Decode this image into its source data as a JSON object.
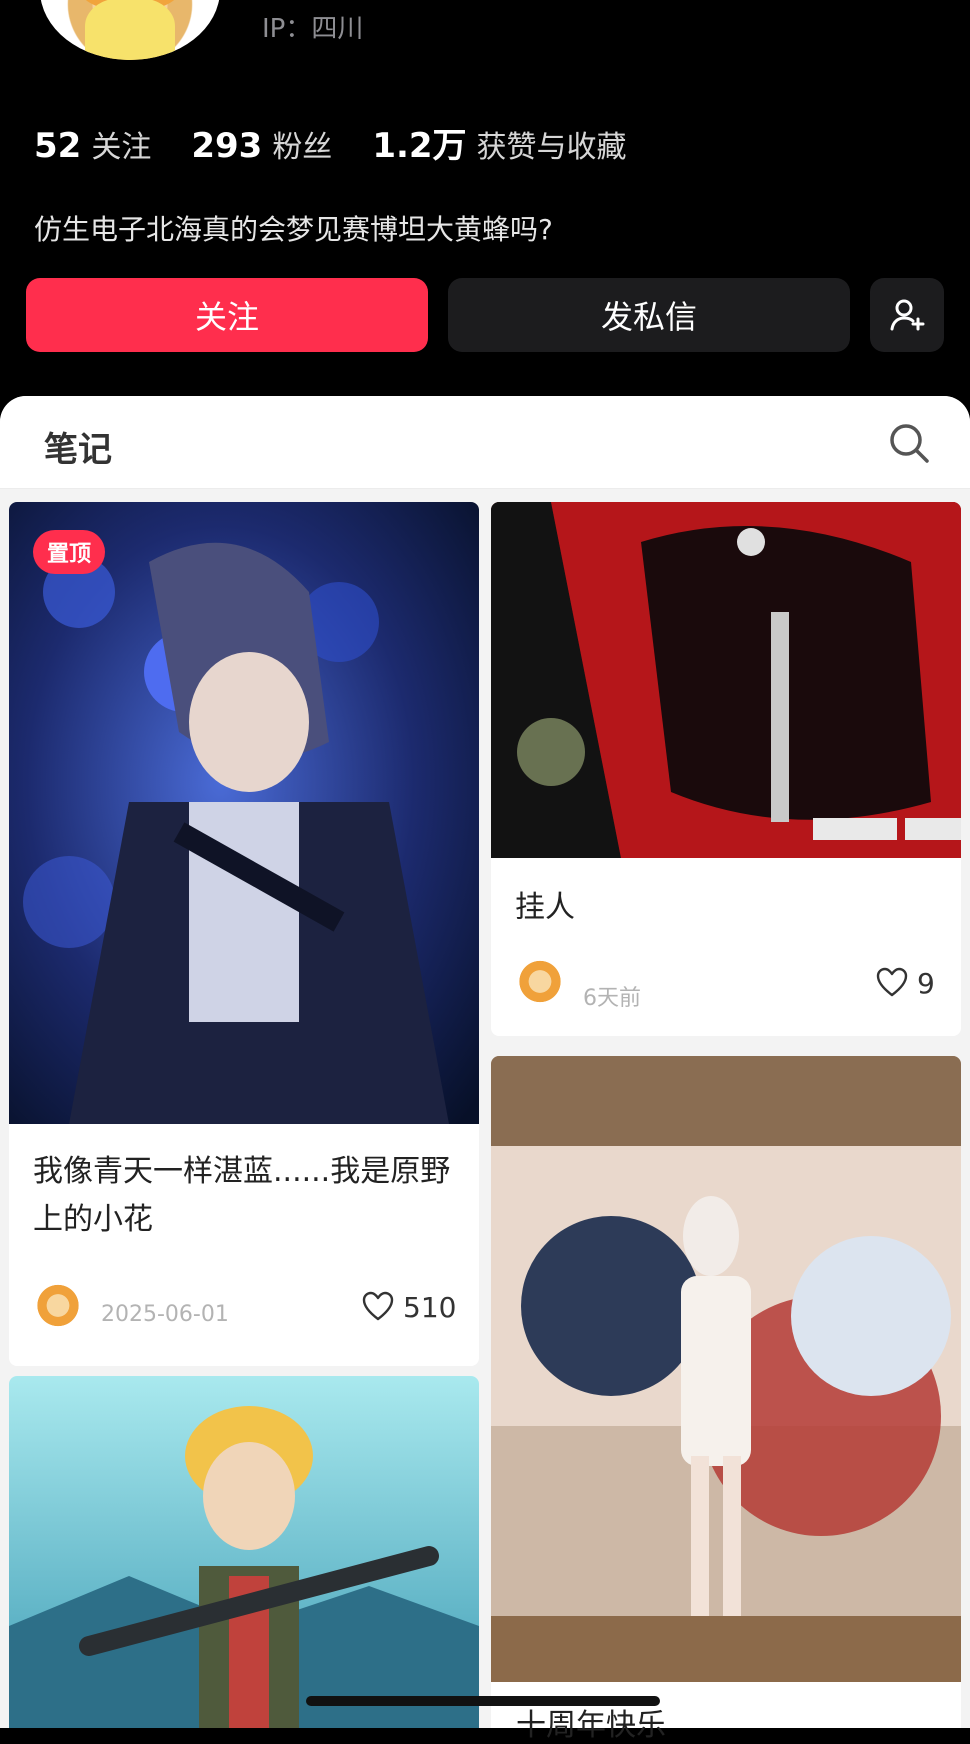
{
  "profile": {
    "ip": "IP：四川",
    "stats": {
      "following_num": "52",
      "following_label": "关注",
      "fans_num": "293",
      "fans_label": "粉丝",
      "likes_num": "1.2万",
      "likes_label": "获赞与收藏"
    },
    "bio": "仿生电子北海真的会梦见赛博坦大黄蜂吗?",
    "buttons": {
      "follow": "关注",
      "message": "发私信"
    }
  },
  "notes": {
    "tab_label": "笔记",
    "cards": [
      {
        "pin": "置顶",
        "title": "我像青天一样湛蓝......我是原野上的小花",
        "date": "2025-06-01",
        "likes": "510"
      },
      {
        "title": "挂人",
        "date": "6天前",
        "likes": "9"
      },
      {
        "title": "十周年快乐"
      }
    ]
  },
  "colors": {
    "accent": "#ff2e4d",
    "dark_button": "#1c1c1e"
  },
  "icons": {
    "search": "search-icon",
    "add_friend": "add-friend-icon",
    "heart": "heart-icon"
  }
}
